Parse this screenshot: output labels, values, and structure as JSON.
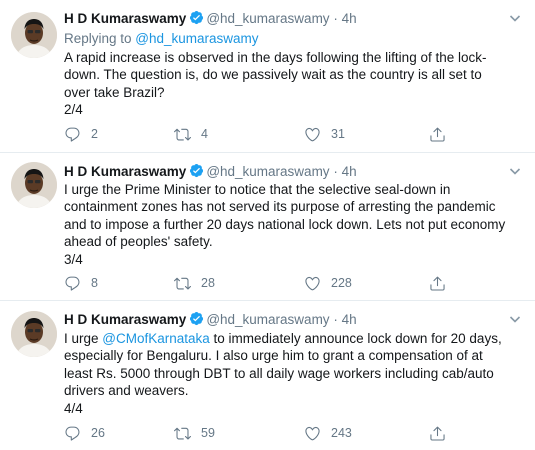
{
  "tweets": [
    {
      "name": "H D Kumaraswamy",
      "handle": "@hd_kumaraswamy",
      "dot": "·",
      "time": "4h",
      "replying_prefix": "Replying to ",
      "replying_handle": "@hd_kumaraswamy",
      "lines": [
        "A rapid increase is observed in the days following the lifting of the lock-",
        "down. The question is, do we passively wait as the country is all set to",
        "over take Brazil?",
        "2/4"
      ],
      "replies": "2",
      "retweets": "4",
      "likes": "31"
    },
    {
      "name": "H D Kumaraswamy",
      "handle": "@hd_kumaraswamy",
      "dot": "·",
      "time": "4h",
      "lines": [
        "I urge the Prime Minister to notice that the selective seal-down in",
        "containment zones has not served its purpose of arresting the pandemic",
        "and to impose a further 20 days national lock down. Lets not put economy",
        "ahead of peoples' safety.",
        "3/4"
      ],
      "replies": "8",
      "retweets": "28",
      "likes": "228"
    },
    {
      "name": "H D Kumaraswamy",
      "handle": "@hd_kumaraswamy",
      "dot": "·",
      "time": "4h",
      "line1_prefix": "I urge ",
      "line1_mention": "@CMofKarnataka",
      "line1_suffix": " to immediately announce lock down for 20 days,",
      "lines": [
        "especially for Bengaluru. I also urge him to grant a compensation of at",
        "least Rs. 5000 through DBT to all daily wage workers including cab/auto",
        "drivers and weavers.",
        "4/4"
      ],
      "replies": "26",
      "retweets": "59",
      "likes": "243"
    }
  ],
  "colors": {
    "text": "#14171a",
    "secondary": "#657786",
    "link": "#1b95e0",
    "verified": "#1da1f2",
    "divider": "#e6ecf0"
  },
  "icons": [
    "verified-badge-icon",
    "chevron-down-icon",
    "reply-icon",
    "retweet-icon",
    "like-icon",
    "share-icon"
  ]
}
